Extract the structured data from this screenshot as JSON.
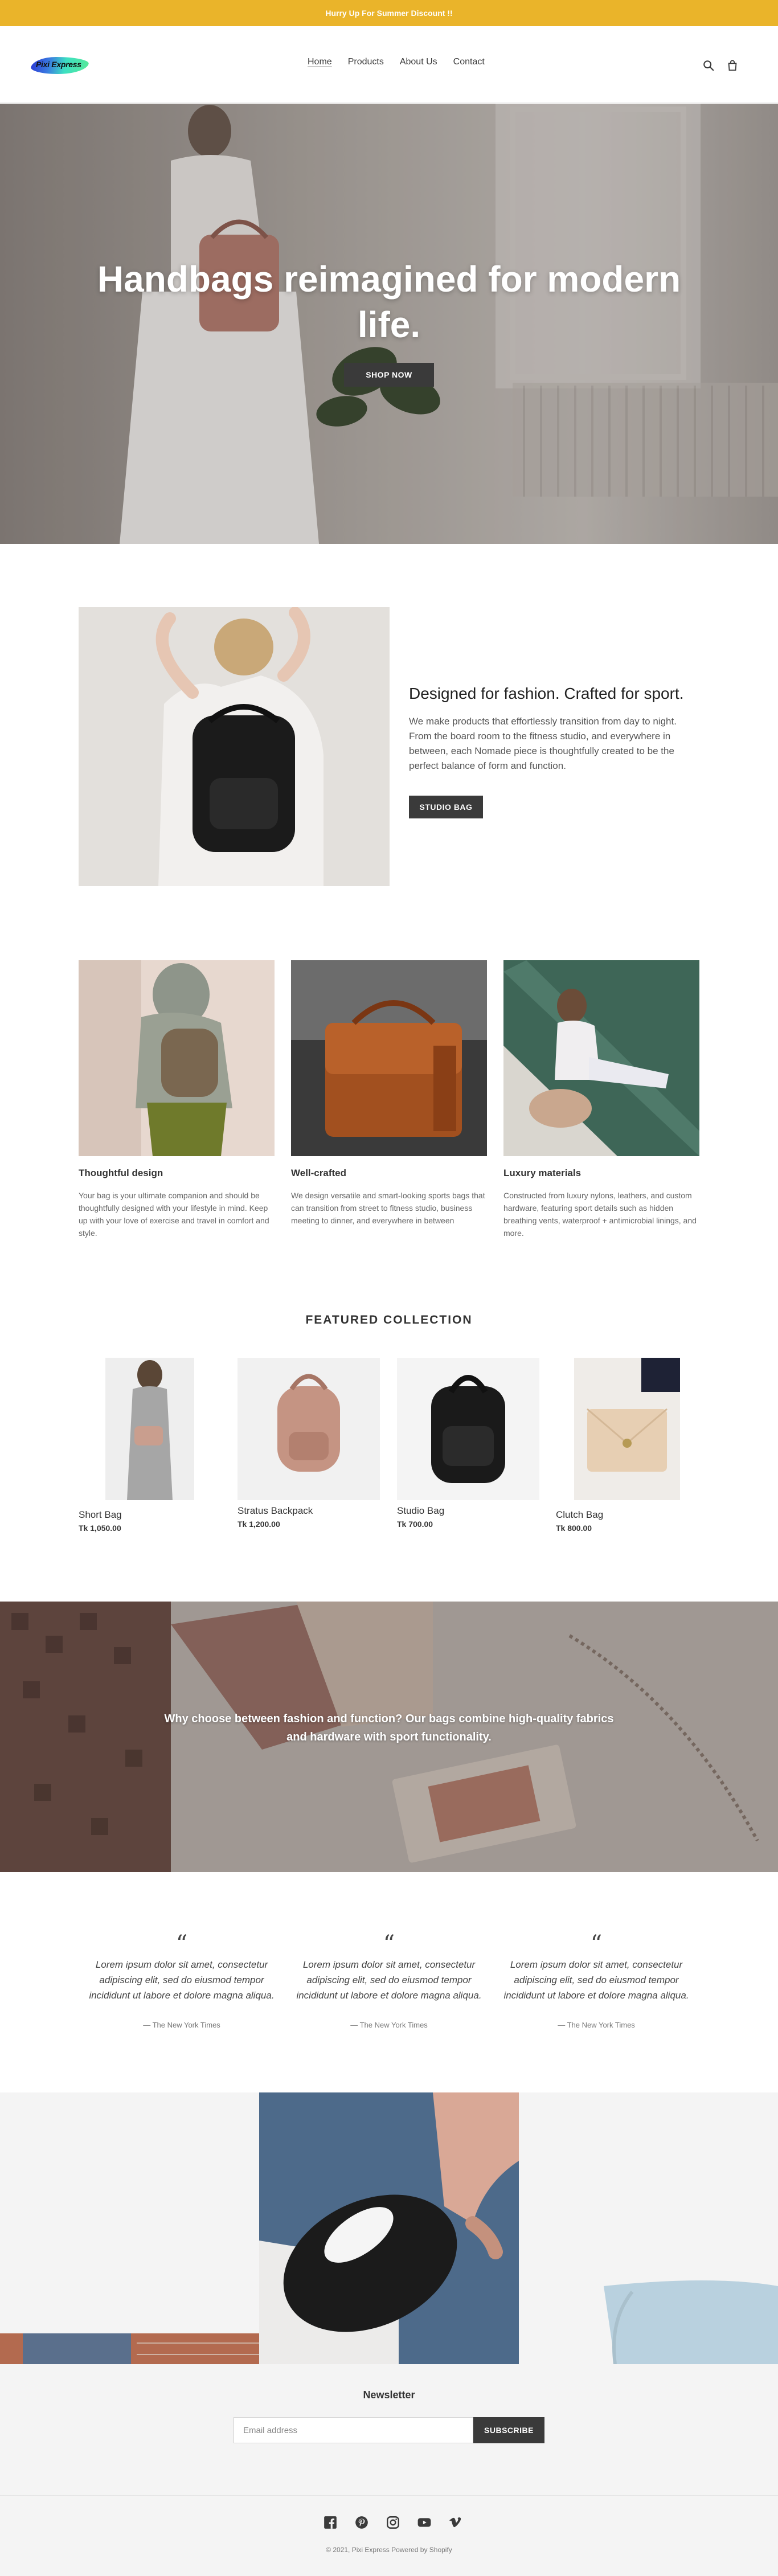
{
  "announcement": {
    "text": "Hurry Up For Summer Discount !!"
  },
  "header": {
    "logo_text": "Pixi Express",
    "nav": [
      {
        "label": "Home",
        "active": true
      },
      {
        "label": "Products",
        "active": false
      },
      {
        "label": "About Us",
        "active": false
      },
      {
        "label": "Contact",
        "active": false
      }
    ],
    "icons": [
      "search-icon",
      "cart-icon"
    ]
  },
  "hero": {
    "title": "Handbags reimagined for modern life.",
    "button_label": "SHOP NOW"
  },
  "feature": {
    "title": "Designed for fashion. Crafted for sport.",
    "text": "We make products that effortlessly transition from day to night. From the board room to the fitness studio, and everywhere in between, each Nomade piece is thoughtfully created to be the perfect balance of form and function.",
    "button_label": "STUDIO BAG"
  },
  "columns": [
    {
      "title": "Thoughtful design",
      "text": "Your bag is your ultimate companion and should be thoughtfully designed with your lifestyle in mind. Keep up with your love of exercise and travel in comfort and style."
    },
    {
      "title": "Well-crafted",
      "text": "We design versatile and smart-looking sports bags that can transition from street to fitness studio, business meeting to dinner, and everywhere in between"
    },
    {
      "title": "Luxury materials",
      "text": "Constructed from luxury nylons, leathers, and custom hardware, featuring sport details such as hidden breathing vents, waterproof + antimicrobial linings, and more."
    }
  ],
  "featured": {
    "title": "FEATURED COLLECTION",
    "products": [
      {
        "name": "Short Bag",
        "price": "Tk 1,050.00"
      },
      {
        "name": "Stratus Backpack",
        "price": "Tk 1,200.00"
      },
      {
        "name": "Studio Bag",
        "price": "Tk 700.00"
      },
      {
        "name": "Clutch Bag",
        "price": "Tk 800.00"
      }
    ]
  },
  "banner": {
    "text": "Why choose between fashion and function? Our bags combine high-quality fabrics and hardware with sport functionality."
  },
  "testimonials": [
    {
      "mark": "“",
      "quote": "Lorem ipsum dolor sit amet, consectetur adipiscing elit, sed do eiusmod tempor incididunt ut labore et dolore magna aliqua.",
      "cite": "— The New York Times"
    },
    {
      "mark": "“",
      "quote": "Lorem ipsum dolor sit amet, consectetur adipiscing elit, sed do eiusmod tempor incididunt ut labore et dolore magna aliqua.",
      "cite": "— The New York Times"
    },
    {
      "mark": "“",
      "quote": "Lorem ipsum dolor sit amet, consectetur adipiscing elit, sed do eiusmod tempor incididunt ut labore et dolore magna aliqua.",
      "cite": "— The New York Times"
    }
  ],
  "newsletter": {
    "title": "Newsletter",
    "placeholder": "Email address",
    "button_label": "SUBSCRIBE"
  },
  "footer": {
    "social_icons": [
      "facebook-icon",
      "pinterest-icon",
      "instagram-icon",
      "youtube-icon",
      "vimeo-icon"
    ],
    "copyright": "© 2021, Pixi Express Powered by Shopify"
  },
  "colors": {
    "announcement_bg": "#eab42a",
    "button_dark": "#3a3a3a",
    "footer_bg": "#f4f4f4"
  }
}
